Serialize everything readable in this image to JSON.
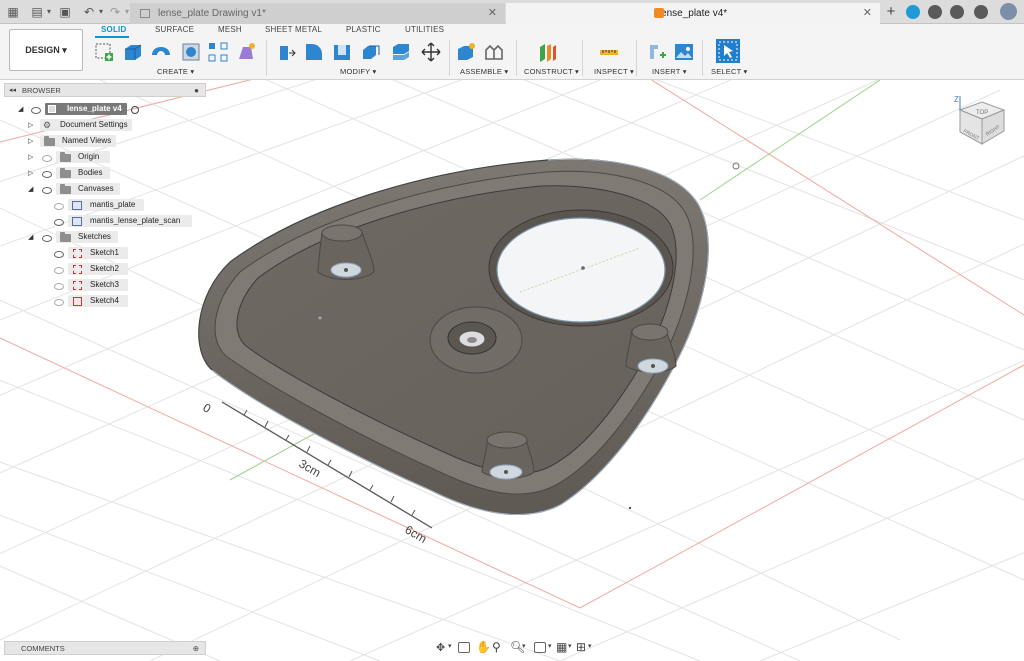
{
  "tabs": {
    "inactive": "lense_plate Drawing v1*",
    "active": "lense_plate v4*",
    "close": "✕"
  },
  "toolbar": {
    "design_label": "DESIGN ▾",
    "workspace_tabs": [
      "SOLID",
      "SURFACE",
      "MESH",
      "SHEET METAL",
      "PLASTIC",
      "UTILITIES"
    ],
    "groups": [
      "CREATE ▾",
      "MODIFY ▾",
      "ASSEMBLE ▾",
      "CONSTRUCT ▾",
      "INSPECT ▾",
      "INSERT ▾",
      "SELECT ▾"
    ]
  },
  "browser": {
    "title": "BROWSER",
    "root": "lense_plate v4",
    "items": [
      "Document Settings",
      "Named Views",
      "Origin",
      "Bodies",
      "Canvases",
      "mantis_plate",
      "mantis_lense_plate_scan",
      "Sketches",
      "Sketch1",
      "Sketch2",
      "Sketch3",
      "Sketch4"
    ]
  },
  "comments": {
    "title": "COMMENTS"
  },
  "viewcube": {
    "top": "TOP",
    "front": "FRONT",
    "right": "RIGHT",
    "axis": "Z"
  },
  "scan": {
    "zero": "0",
    "mid": "3cm",
    "end": "6cm"
  },
  "colors": {
    "accent": "#0696d7",
    "body": "#6f6963",
    "sketch": "#c33"
  }
}
